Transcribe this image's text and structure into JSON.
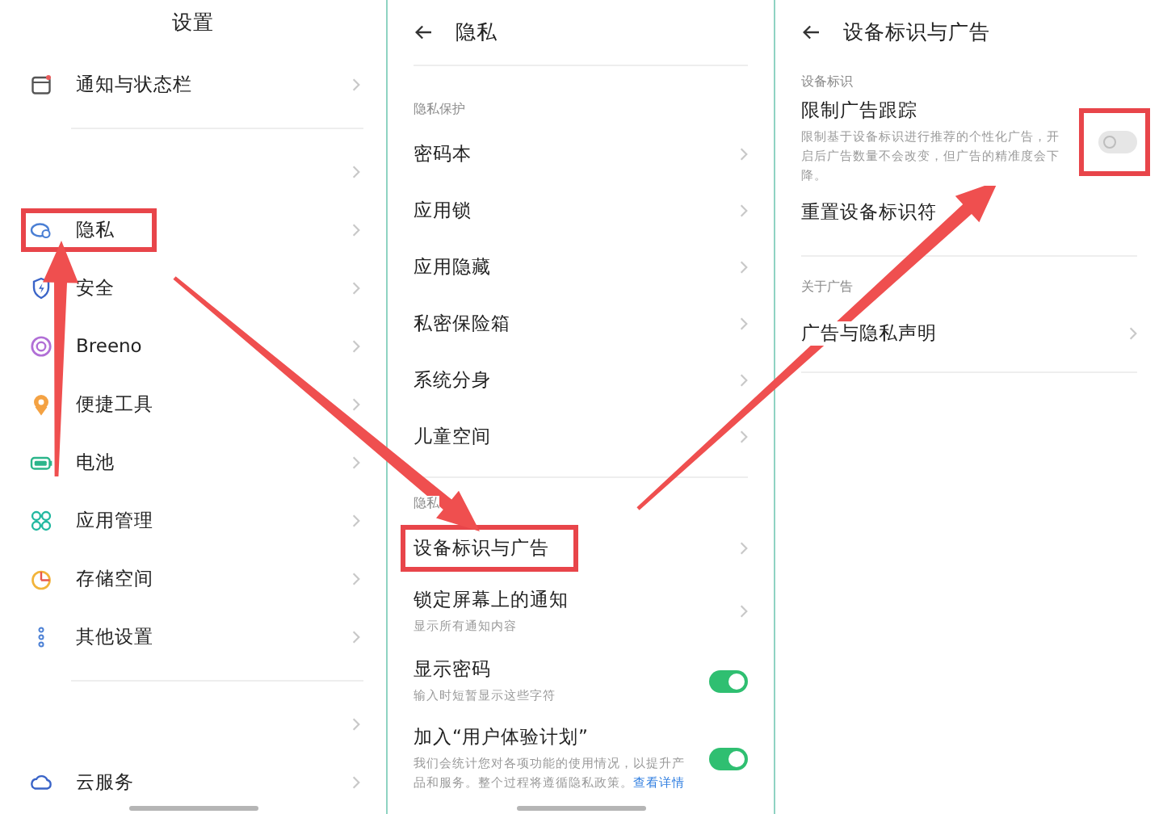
{
  "settings_screen": {
    "title": "设置",
    "items": [
      {
        "kind": "item",
        "label": "通知与状态栏",
        "highlighted": false
      },
      {
        "kind": "divider"
      },
      {
        "kind": "blank"
      },
      {
        "kind": "item",
        "label": "隐私",
        "highlighted": true
      },
      {
        "kind": "item",
        "label": "安全",
        "highlighted": false
      },
      {
        "kind": "item",
        "label": "Breeno",
        "highlighted": false
      },
      {
        "kind": "item",
        "label": "便捷工具",
        "highlighted": false
      },
      {
        "kind": "item",
        "label": "电池",
        "highlighted": false
      },
      {
        "kind": "item",
        "label": "应用管理",
        "highlighted": false
      },
      {
        "kind": "item",
        "label": "存储空间",
        "highlighted": false
      },
      {
        "kind": "item",
        "label": "其他设置",
        "highlighted": false
      },
      {
        "kind": "divider"
      },
      {
        "kind": "blank"
      },
      {
        "kind": "item",
        "label": "云服务",
        "highlighted": false
      }
    ]
  },
  "privacy_screen": {
    "title": "隐私",
    "sections": [
      {
        "header": "隐私保护",
        "items": [
          {
            "kind": "link",
            "label": "密码本",
            "highlighted": false
          },
          {
            "kind": "link",
            "label": "应用锁",
            "highlighted": false
          },
          {
            "kind": "link",
            "label": "应用隐藏",
            "highlighted": false
          },
          {
            "kind": "link",
            "label": "私密保险箱",
            "highlighted": false
          },
          {
            "kind": "link",
            "label": "系统分身",
            "highlighted": false
          },
          {
            "kind": "link",
            "label": "儿童空间",
            "highlighted": false
          }
        ]
      },
      {
        "header": "隐私",
        "items": [
          {
            "kind": "link",
            "label": "设备标识与广告",
            "highlighted": true
          },
          {
            "kind": "link",
            "label": "锁定屏幕上的通知",
            "subtitle": "显示所有通知内容",
            "highlighted": false
          },
          {
            "kind": "toggle",
            "label": "显示密码",
            "subtitle": "输入时短暂显示这些字符",
            "on": true,
            "highlighted": false
          },
          {
            "kind": "toggle",
            "label": "加入“用户体验计划”",
            "subtitle": "我们会统计您对各项功能的使用情况，以提升产品和服务。整个过程将遵循隐私政策。",
            "link": "查看详情",
            "on": true,
            "highlighted": false
          }
        ]
      }
    ]
  },
  "ad_screen": {
    "title": "设备标识与广告",
    "sections": [
      {
        "header": "设备标识",
        "items": [
          {
            "kind": "toggle",
            "label": "限制广告跟踪",
            "subtitle": "限制基于设备标识进行推荐的个性化广告，开启后广告数量不会改变，但广告的精准度会下降。",
            "on": false,
            "highlighted": true
          },
          {
            "kind": "plain",
            "label": "重置设备标识符",
            "highlighted": false
          }
        ]
      },
      {
        "header": "关于广告",
        "items": [
          {
            "kind": "link",
            "label": "广告与隐私声明",
            "highlighted": false
          }
        ]
      }
    ]
  }
}
